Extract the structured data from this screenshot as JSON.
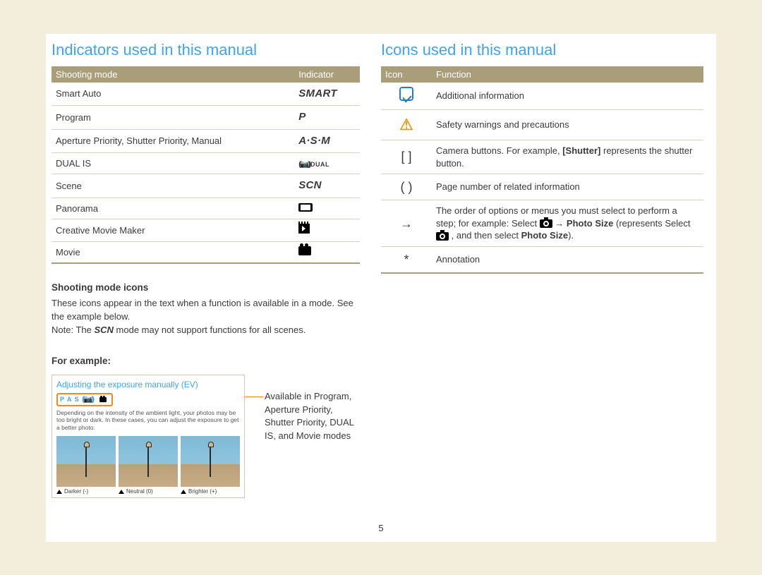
{
  "left": {
    "heading": "Indicators used in this manual",
    "table": {
      "head": [
        "Shooting mode",
        "Indicator"
      ],
      "rows": [
        {
          "mode": "Smart Auto",
          "indicator": "SMART",
          "style": "ind"
        },
        {
          "mode": "Program",
          "indicator": "P",
          "style": "ind"
        },
        {
          "mode": "Aperture Priority, Shutter Priority, Manual",
          "indicator": "A·S·M",
          "style": "ind"
        },
        {
          "mode": "DUAL IS",
          "indicator": "DUAL",
          "style": "dual"
        },
        {
          "mode": "Scene",
          "indicator": "SCN",
          "style": "ind"
        },
        {
          "mode": "Panorama",
          "indicator": "",
          "style": "pano"
        },
        {
          "mode": "Creative Movie Maker",
          "indicator": "",
          "style": "film"
        },
        {
          "mode": "Movie",
          "indicator": "",
          "style": "film2"
        }
      ]
    },
    "sub1": "Shooting mode icons",
    "para1": "These icons appear in the text when a function is available in a mode. See the example below.",
    "note_pre": "Note: The ",
    "note_scn": "SCN",
    "note_post": " mode may not support functions for all scenes.",
    "sub2": "For example:",
    "example": {
      "title": "Adjusting the exposure manually (EV)",
      "iconrow": "P A S",
      "desc": "Depending on the intensity of the ambient light, your photos may be too bright or dark. In these cases, you can adjust the exposure to get a better photo.",
      "caps": [
        "Darker (-)",
        "Neutral (0)",
        "Brighter (+)"
      ]
    },
    "callout": "Available in Program, Aperture Priority, Shutter Priority, DUAL IS, and Movie modes"
  },
  "right": {
    "heading": "Icons used in this manual",
    "table": {
      "head": [
        "Icon",
        "Function"
      ],
      "rows": [
        {
          "icon": "info",
          "text": "Additional information"
        },
        {
          "icon": "warn",
          "text": "Safety warnings and precautions"
        },
        {
          "icon": "brackets",
          "label": "[  ]",
          "text_pre": "Camera buttons. For example, ",
          "bold1": "[Shutter]",
          "text_post": " represents the shutter button."
        },
        {
          "icon": "paren",
          "label": "(  )",
          "text": "Page number of related information"
        },
        {
          "icon": "arrow",
          "label": "→",
          "text_pre": "The order of options or menus you must select to perform a step; for example: Select ",
          "cam": true,
          "arrow_mid": " → ",
          "bold1": "Photo Size",
          "text_mid": " (represents Select ",
          "cam2": true,
          "text_mid2": " , and then select ",
          "bold2": "Photo Size",
          "text_post": ")."
        },
        {
          "icon": "star",
          "label": "*",
          "text": "Annotation"
        }
      ]
    }
  },
  "pagenum": "5"
}
